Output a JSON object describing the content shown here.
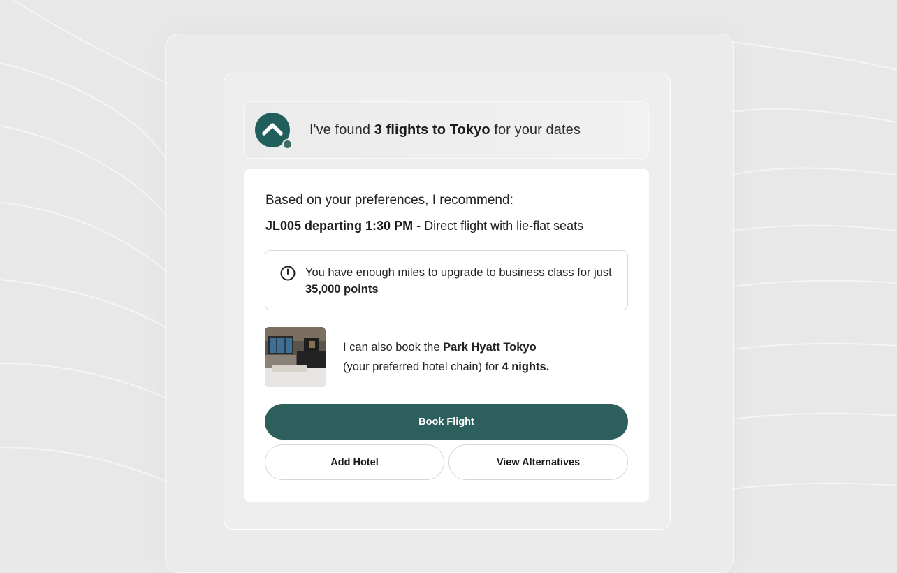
{
  "assistant_message": {
    "prefix": "I've found ",
    "highlight": "3 flights to Tokyo",
    "suffix": " for your dates"
  },
  "recommendation": {
    "intro": "Based on your preferences, I recommend:",
    "flight_code": "JL005 departing 1:30 PM",
    "flight_detail": " - Direct flight with lie-flat seats"
  },
  "upgrade_notice": {
    "icon": "clock-icon",
    "text": "You have enough miles to upgrade to business class for just ",
    "points": "35,000 points"
  },
  "hotel": {
    "text_prefix": "I can also book the ",
    "name": "Park Hyatt Tokyo",
    "text_middle": "(your preferred hotel chain) for ",
    "nights": "4 nights."
  },
  "actions": {
    "primary": "Book Flight",
    "secondary_1": "Add Hotel",
    "secondary_2": "View Alternatives"
  },
  "colors": {
    "brand": "#215f5d",
    "button": "#2d5f5d"
  }
}
